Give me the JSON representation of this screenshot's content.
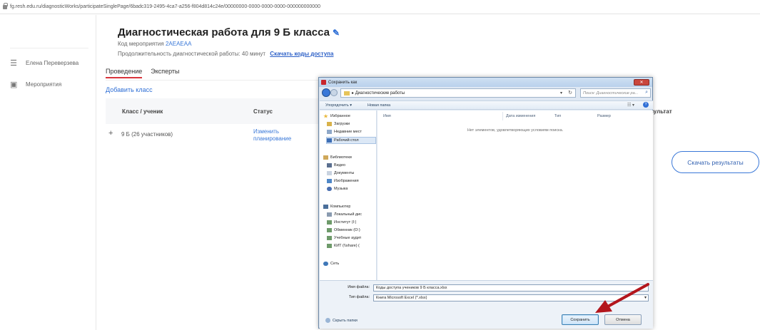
{
  "browser": {
    "url": "fg.resh.edu.ru/diagnosticWorks/participateSinglePage/6badc319-2495-4ca7-a256-f804d814c24e/00000000-0000-0000-0000-000000000000"
  },
  "sidebar": {
    "user": "Елена Переверзева",
    "events": "Мероприятия"
  },
  "header": {
    "title": "Диагностическая работа для 9 Б класса",
    "code_label": "Код мероприятия",
    "code_value": "2AEAEAA",
    "duration_text": "Продолжительность диагностической работы: 40 минут",
    "download_codes": "Скачать коды доступа"
  },
  "tabs": [
    {
      "label": "Проведение",
      "active": true
    },
    {
      "label": "Эксперты",
      "active": false
    }
  ],
  "add_class": "Добавить класс",
  "table": {
    "columns": {
      "class": "Класс / ученик",
      "status": "Статус",
      "result": "зультат"
    },
    "rows": [
      {
        "toggle": "+",
        "class": "9 Б (26 участников)",
        "status": "Изменить планирование"
      }
    ]
  },
  "download_results": "Скачать результаты",
  "dialog": {
    "title": "Сохранить как",
    "close": "✕",
    "path_folder": "Диагностические работы",
    "path_prefix": "▸",
    "search_placeholder": "Поиск: Диагностические ра...",
    "toolbar": {
      "organize": "Упорядочить ▾",
      "new_folder": "Новая папка"
    },
    "nav": {
      "favorites": "Избранное",
      "downloads": "Загрузки",
      "recent": "Недавние мест",
      "desktop": "Рабочий стол",
      "libraries": "Библиотеки",
      "video": "Видео",
      "documents": "Документы",
      "pictures": "Изображения",
      "music": "Музыка",
      "computer": "Компьютер",
      "local_disk": "Локальный дис",
      "institute": "Институт (I:)",
      "exchange": "Обменник (O:)",
      "classrooms": "Учебные аудит",
      "kit": "КИТ (\\\\share) (",
      "network": "Сеть"
    },
    "columns": {
      "name": "Имя",
      "modified": "Дата изменения",
      "type": "Тип",
      "size": "Размер"
    },
    "empty_message": "Нет элементов, удовлетворяющих условиям поиска.",
    "file_name_label": "Имя файла:",
    "file_name_value": "Коды доступа учеников 9 Б класса.xlsx",
    "file_type_label": "Тип файла:",
    "file_type_value": "Книга Microsoft Excel (*.xlsx)",
    "hide_folders": "Скрыть папки",
    "save": "Сохранить",
    "cancel": "Отмена"
  },
  "colors": {
    "accent": "#2f6fd6",
    "tab_underline": "#d9343b",
    "arrow": "#b3161d"
  }
}
